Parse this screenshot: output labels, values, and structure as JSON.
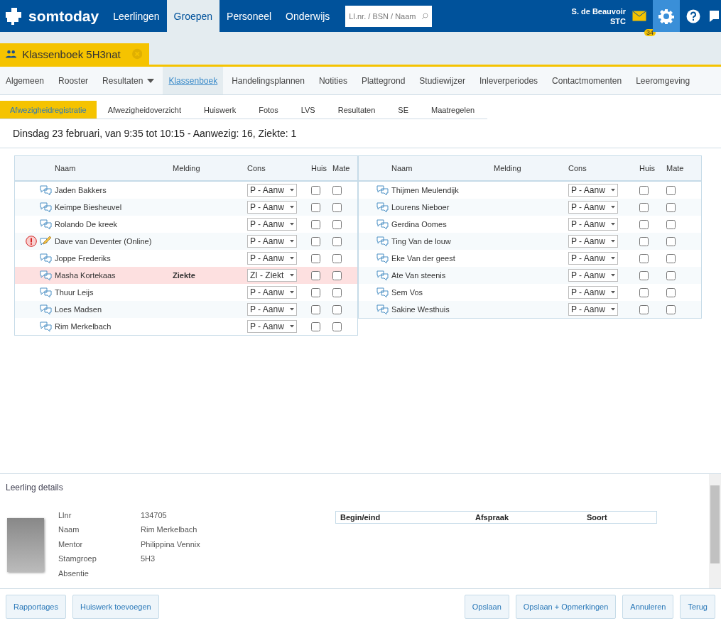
{
  "topbar": {
    "logo": "somtoday",
    "nav": [
      {
        "label": "Leerlingen",
        "selected": false
      },
      {
        "label": "Groepen",
        "selected": true
      },
      {
        "label": "Personeel",
        "selected": false
      },
      {
        "label": "Onderwijs",
        "selected": false
      }
    ],
    "search": {
      "placeholder": "Ll.nr. / BSN / Naam"
    },
    "user": {
      "name": "S. de Beauvoir",
      "org": "STC"
    },
    "mail_count": "34"
  },
  "doc_tab": {
    "title": "Klassenboek 5H3nat"
  },
  "nav": [
    {
      "label": "Algemeen",
      "selected": false,
      "dropdown": false
    },
    {
      "label": "Rooster",
      "selected": false,
      "dropdown": false
    },
    {
      "label": "Resultaten",
      "selected": false,
      "dropdown": true
    },
    {
      "label": "Klassenboek",
      "selected": true,
      "dropdown": false
    },
    {
      "label": "Handelingsplannen",
      "selected": false,
      "dropdown": false
    },
    {
      "label": "Notities",
      "selected": false,
      "dropdown": false
    },
    {
      "label": "Plattegrond",
      "selected": false,
      "dropdown": false
    },
    {
      "label": "Studiewijzer",
      "selected": false,
      "dropdown": false
    },
    {
      "label": "Inleverperiodes",
      "selected": false,
      "dropdown": false
    },
    {
      "label": "Contactmomenten",
      "selected": false,
      "dropdown": false
    },
    {
      "label": "Leeromgeving",
      "selected": false,
      "dropdown": false
    }
  ],
  "subtabs": [
    {
      "label": "Afwezigheidregistratie",
      "selected": true
    },
    {
      "label": "Afwezigheidoverzicht",
      "selected": false
    },
    {
      "label": "Huiswerk",
      "selected": false
    },
    {
      "label": "Fotos",
      "selected": false
    },
    {
      "label": "LVS",
      "selected": false
    },
    {
      "label": "Resultaten",
      "selected": false
    },
    {
      "label": "SE",
      "selected": false
    },
    {
      "label": "Maatregelen",
      "selected": false
    }
  ],
  "heading": "Dinsdag 23 februari, van 9:35 tot 10:15 - Aanwezig: 16, Ziekte: 1",
  "tables": [
    {
      "columns": [
        "Naam",
        "Melding",
        "Cons",
        "Huis",
        "Mate"
      ],
      "rows": [
        {
          "name": "Jaden Bakkers",
          "melding": "",
          "cons": "P - Aanw",
          "huis": false,
          "mate": false,
          "alert": false,
          "kind": "comment",
          "highlighted": false
        },
        {
          "name": "Keimpe Biesheuvel",
          "melding": "",
          "cons": "P - Aanw",
          "huis": false,
          "mate": false,
          "alert": false,
          "kind": "comment",
          "highlighted": false
        },
        {
          "name": "Rolando De kreek",
          "melding": "",
          "cons": "P - Aanw",
          "huis": false,
          "mate": false,
          "alert": false,
          "kind": "comment",
          "highlighted": false
        },
        {
          "name": "Dave van Deventer (Online)",
          "melding": "",
          "cons": "P - Aanw",
          "huis": false,
          "mate": false,
          "alert": true,
          "kind": "note",
          "highlighted": false
        },
        {
          "name": "Joppe Frederiks",
          "melding": "",
          "cons": "P - Aanw",
          "huis": false,
          "mate": false,
          "alert": false,
          "kind": "comment",
          "highlighted": false
        },
        {
          "name": "Masha Kortekaas",
          "melding": "Ziekte",
          "cons": "ZI - Ziekt",
          "huis": false,
          "mate": false,
          "alert": false,
          "kind": "comment",
          "highlighted": true
        },
        {
          "name": "Thuur Leijs",
          "melding": "",
          "cons": "P - Aanw",
          "huis": false,
          "mate": false,
          "alert": false,
          "kind": "comment",
          "highlighted": false
        },
        {
          "name": "Loes Madsen",
          "melding": "",
          "cons": "P - Aanw",
          "huis": false,
          "mate": false,
          "alert": false,
          "kind": "comment",
          "highlighted": false
        },
        {
          "name": "Rim Merkelbach",
          "melding": "",
          "cons": "P - Aanw",
          "huis": false,
          "mate": false,
          "alert": false,
          "kind": "comment",
          "highlighted": false
        }
      ]
    },
    {
      "columns": [
        "Naam",
        "Melding",
        "Cons",
        "Huis",
        "Mate"
      ],
      "rows": [
        {
          "name": "Thijmen Meulendijk",
          "melding": "",
          "cons": "P - Aanw",
          "huis": false,
          "mate": false,
          "alert": false,
          "kind": "comment",
          "highlighted": false
        },
        {
          "name": "Lourens Nieboer",
          "melding": "",
          "cons": "P - Aanw",
          "huis": false,
          "mate": false,
          "alert": false,
          "kind": "comment",
          "highlighted": false
        },
        {
          "name": "Gerdina Oomes",
          "melding": "",
          "cons": "P - Aanw",
          "huis": false,
          "mate": false,
          "alert": false,
          "kind": "comment",
          "highlighted": false
        },
        {
          "name": "Ting Van de louw",
          "melding": "",
          "cons": "P - Aanw",
          "huis": false,
          "mate": false,
          "alert": false,
          "kind": "comment",
          "highlighted": false
        },
        {
          "name": "Eke Van der geest",
          "melding": "",
          "cons": "P - Aanw",
          "huis": false,
          "mate": false,
          "alert": false,
          "kind": "comment",
          "highlighted": false
        },
        {
          "name": "Ate Van steenis",
          "melding": "",
          "cons": "P - Aanw",
          "huis": false,
          "mate": false,
          "alert": false,
          "kind": "comment",
          "highlighted": false
        },
        {
          "name": "Sem Vos",
          "melding": "",
          "cons": "P - Aanw",
          "huis": false,
          "mate": false,
          "alert": false,
          "kind": "comment",
          "highlighted": false
        },
        {
          "name": "Sakine Westhuis",
          "melding": "",
          "cons": "P - Aanw",
          "huis": false,
          "mate": false,
          "alert": false,
          "kind": "comment",
          "highlighted": false
        }
      ]
    }
  ],
  "details": {
    "title": "Leerling details",
    "fields": [
      {
        "label": "Llnr",
        "value": "134705"
      },
      {
        "label": "Naam",
        "value": "Rim Merkelbach"
      },
      {
        "label": "Mentor",
        "value": "Philippina Vennix"
      },
      {
        "label": "Stamgroep",
        "value": "5H3"
      },
      {
        "label": "Absentie"
      }
    ],
    "appointments_columns": [
      "Begin/eind",
      "Afspraak",
      "Soort"
    ]
  },
  "footer": {
    "left": [
      "Rapportages",
      "Huiswerk toevoegen"
    ],
    "right": [
      "Opslaan",
      "Opslaan + Opmerkingen",
      "Annuleren",
      "Terug"
    ]
  }
}
